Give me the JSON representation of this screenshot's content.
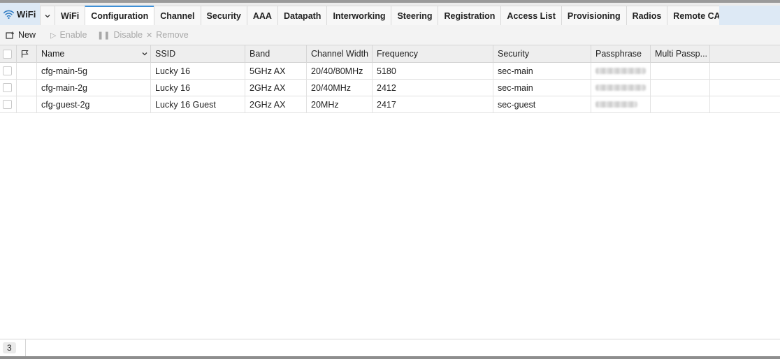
{
  "app": {
    "title": "WiFi",
    "icon": "wifi-icon"
  },
  "tabs": [
    {
      "label": "WiFi"
    },
    {
      "label": "Configuration",
      "active": true
    },
    {
      "label": "Channel"
    },
    {
      "label": "Security"
    },
    {
      "label": "AAA"
    },
    {
      "label": "Datapath"
    },
    {
      "label": "Interworking"
    },
    {
      "label": "Steering"
    },
    {
      "label": "Registration"
    },
    {
      "label": "Access List"
    },
    {
      "label": "Provisioning"
    },
    {
      "label": "Radios"
    },
    {
      "label": "Remote CAP"
    }
  ],
  "toolbar": {
    "new_label": "New",
    "enable_label": "Enable",
    "disable_label": "Disable",
    "remove_label": "Remove"
  },
  "table": {
    "columns": [
      "Name",
      "SSID",
      "Band",
      "Channel Width",
      "Frequency",
      "Security",
      "Passphrase",
      "Multi Passp..."
    ],
    "rows": [
      {
        "name": "cfg-main-5g",
        "ssid": "Lucky 16",
        "band": "5GHz AX",
        "channel_width": "20/40/80MHz",
        "frequency": "5180",
        "security": "sec-main"
      },
      {
        "name": "cfg-main-2g",
        "ssid": "Lucky 16",
        "band": "2GHz AX",
        "channel_width": "20/40MHz",
        "frequency": "2412",
        "security": "sec-main"
      },
      {
        "name": "cfg-guest-2g",
        "ssid": "Lucky 16 Guest",
        "band": "2GHz AX",
        "channel_width": "20MHz",
        "frequency": "2417",
        "security": "sec-guest"
      }
    ]
  },
  "status": {
    "count": "3"
  },
  "colors": {
    "accent": "#3d8fd6",
    "header_bg": "#dde9f5"
  }
}
